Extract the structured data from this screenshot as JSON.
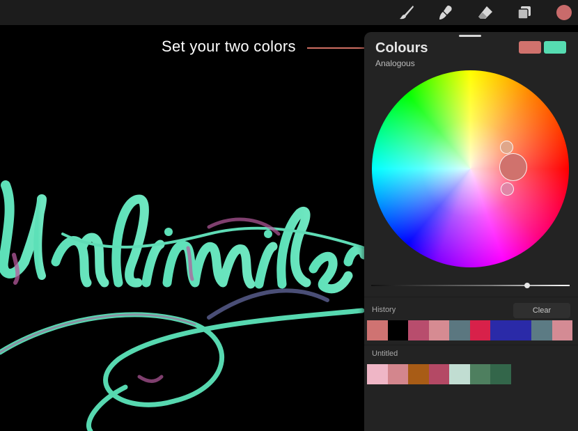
{
  "toolbar": {
    "tools": [
      "brush-icon",
      "smudge-icon",
      "eraser-icon",
      "layers-icon"
    ],
    "current_color": "#c96b6b"
  },
  "annotation": {
    "text": "Set your two colors",
    "line_color": "#d06f63"
  },
  "panel": {
    "title": "Colours",
    "mode": "Analogous",
    "primary_color": "#d0726d",
    "secondary_color": "#56dcb1",
    "history_label": "History",
    "clear_label": "Clear",
    "history": [
      "#cf7372",
      "#000000",
      "#b84d6d",
      "#d68b92",
      "#5b7780",
      "#d8214a",
      "#2a2aa8",
      "#2a2aa8",
      "#5c7b84",
      "#d48b94"
    ],
    "palette_label": "Untitled",
    "palette": [
      "#efb6c6",
      "#d3868d",
      "#a85c16",
      "#b44965",
      "#c1ddd2",
      "#4e7f5f",
      "#33664a"
    ]
  }
}
